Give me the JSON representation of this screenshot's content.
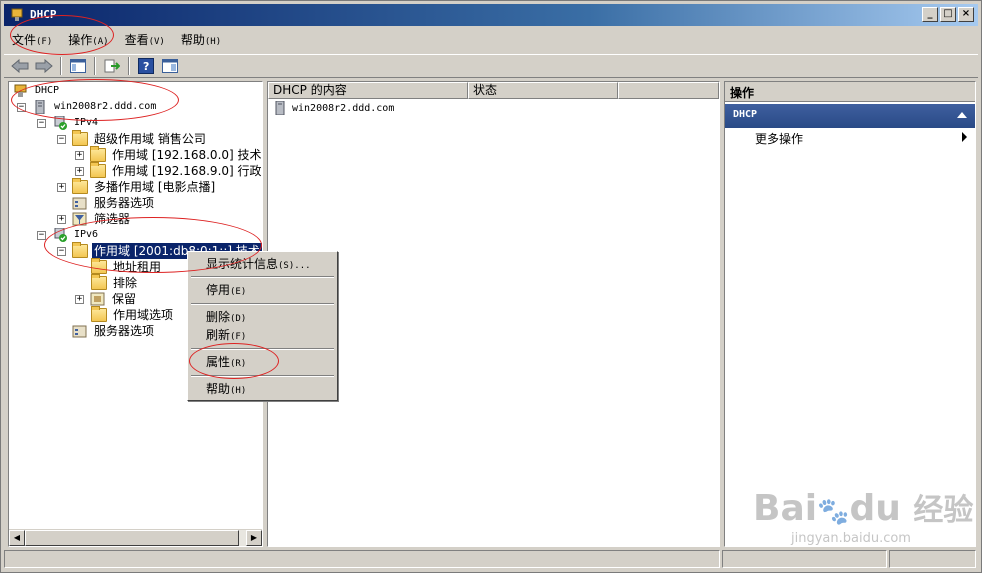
{
  "window": {
    "title": "DHCP"
  },
  "menu": [
    {
      "label": "文件",
      "accel": "(F)"
    },
    {
      "label": "操作",
      "accel": "(A)"
    },
    {
      "label": "查看",
      "accel": "(V)"
    },
    {
      "label": "帮助",
      "accel": "(H)"
    }
  ],
  "toolbar": [
    "back-icon",
    "forward-icon",
    "show-hide-tree-icon",
    "export-list-icon",
    "help-icon",
    "properties-view-icon"
  ],
  "tree": {
    "root": "DHCP",
    "server": "win2008r2.ddd.com",
    "ipv4": "IPv4",
    "superscope": "超级作用域 销售公司",
    "scope1": "作用域 [192.168.0.0] 技术",
    "scope2": "作用域 [192.168.9.0] 行政",
    "multicast": "多播作用域 [电影点播]",
    "server_options_v4": "服务器选项",
    "filters": "筛选器",
    "ipv6": "IPv6",
    "scope_v6": "作用域 [2001:db8:0:1::] 技术",
    "leases": "地址租用",
    "exclusions": "排除",
    "reservations": "保留",
    "scope_options": "作用域选项",
    "server_options_v6": "服务器选项"
  },
  "content": {
    "col_name": "DHCP 的内容",
    "col_status": "状态",
    "row1": "win2008r2.ddd.com"
  },
  "actions": {
    "title": "操作",
    "band": "DHCP",
    "more": "更多操作"
  },
  "context_menu": {
    "stats": "显示统计信息",
    "stats_accel": "(S)...",
    "disable": "停用",
    "disable_accel": "(E)",
    "delete": "删除",
    "delete_accel": "(D)",
    "refresh": "刷新",
    "refresh_accel": "(F)",
    "properties": "属性",
    "properties_accel": "(R)",
    "help": "帮助",
    "help_accel": "(H)"
  },
  "watermark": {
    "brand": "Bai",
    "brand2": "du",
    "brand_cn": "经验",
    "url": "jingyan.baidu.com"
  },
  "colors": {
    "title_start": "#0a246a",
    "selection": "#0a246a",
    "annotation": "#d22222"
  }
}
